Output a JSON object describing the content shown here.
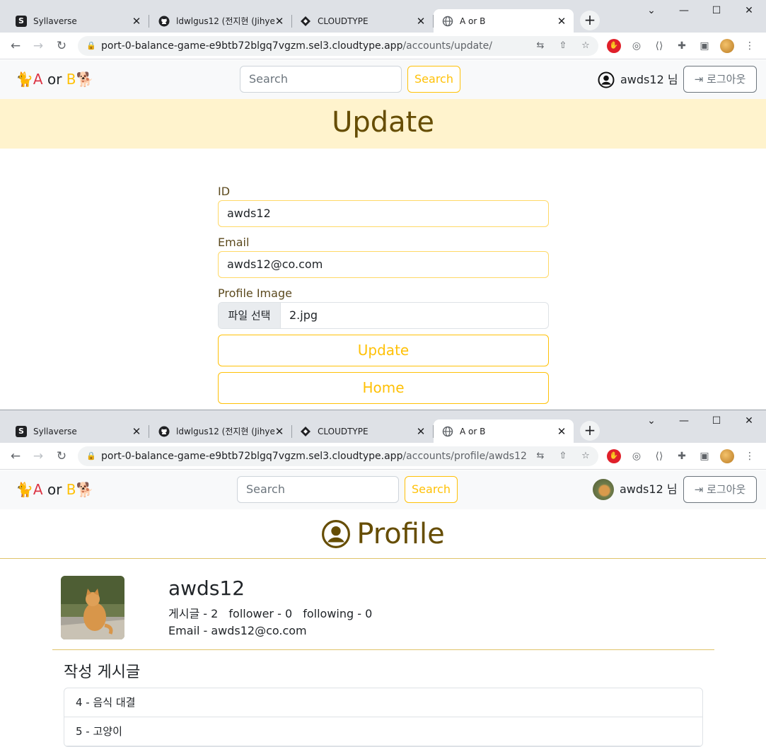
{
  "browser": {
    "tabs": [
      {
        "title": "Syllaverse",
        "icon": "s-logo-icon",
        "active": false
      },
      {
        "title": "ldwlgus12 (전지현 (Jihyeon",
        "icon": "github-icon",
        "active": false
      },
      {
        "title": "CLOUDTYPE",
        "icon": "cloudtype-icon",
        "active": false
      },
      {
        "title": "A or B",
        "icon": "globe-icon",
        "active": true
      }
    ],
    "window_controls": [
      "⌄",
      "—",
      "☐",
      "✕"
    ]
  },
  "update_window": {
    "url_host": "port-0-balance-game-e9btb72blgq7vgzm.sel3.cloudtype.app",
    "url_path": "/accounts/update/"
  },
  "profile_window": {
    "url_host": "port-0-balance-game-e9btb72blgq7vgzm.sel3.cloudtype.app",
    "url_path": "/accounts/profile/awds12"
  },
  "site": {
    "brand_a": "A",
    "brand_or": "or",
    "brand_b": "B",
    "search_placeholder": "Search",
    "search_button": "Search",
    "username_display": "awds12 님",
    "logout_button": "로그아웃"
  },
  "update_page": {
    "title": "Update",
    "id_label": "ID",
    "id_value": "awds12",
    "email_label": "Email",
    "email_value": "awds12@co.com",
    "image_label": "Profile Image",
    "file_button": "파일 선택",
    "file_name": "2.jpg",
    "update_button": "Update",
    "home_button": "Home"
  },
  "profile_page": {
    "title": "Profile",
    "username": "awds12",
    "posts_stat": "게시글 - 2",
    "follower_stat": "follower - 0",
    "following_stat": "following - 0",
    "email_line": "Email - awds12@co.com",
    "section_title": "작성 게시글",
    "posts": [
      "4 - 음식 대결",
      "5 - 고양이"
    ]
  },
  "colors": {
    "accent": "#ffc107",
    "banner_bg": "#fff3cd",
    "banner_text": "#664d03",
    "brand_a": "#dc3545"
  }
}
